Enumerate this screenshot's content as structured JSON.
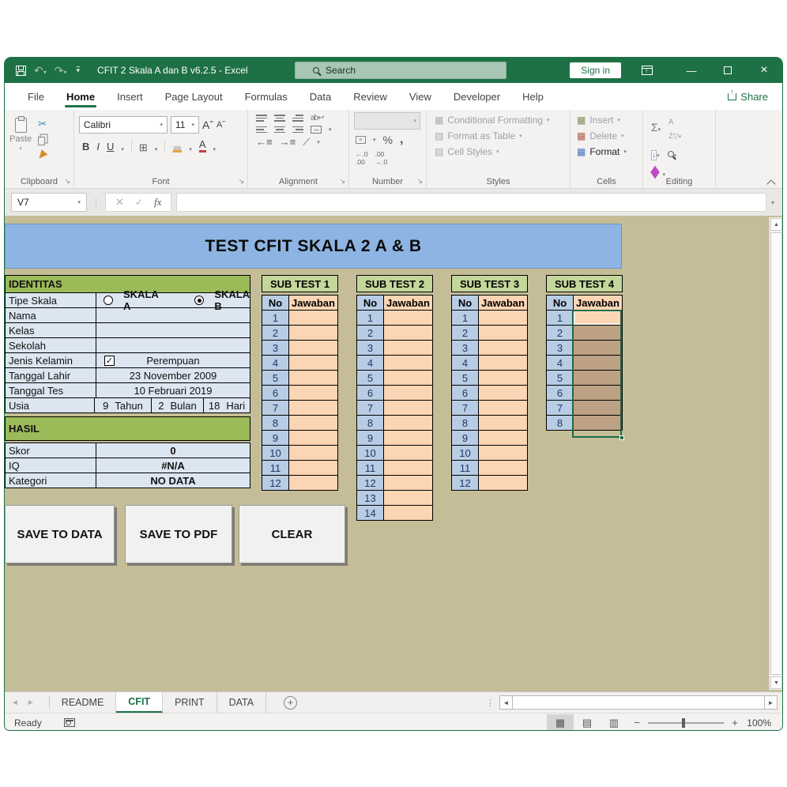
{
  "window": {
    "title": "CFIT 2 Skala A dan B v6.2.5  -  Excel"
  },
  "titlebar": {
    "search_placeholder": "Search",
    "sign_in": "Sign in"
  },
  "menu": {
    "tabs": [
      {
        "label": "File",
        "active": false
      },
      {
        "label": "Home",
        "active": true
      },
      {
        "label": "Insert",
        "active": false
      },
      {
        "label": "Page Layout",
        "active": false
      },
      {
        "label": "Formulas",
        "active": false
      },
      {
        "label": "Data",
        "active": false
      },
      {
        "label": "Review",
        "active": false
      },
      {
        "label": "View",
        "active": false
      },
      {
        "label": "Developer",
        "active": false
      },
      {
        "label": "Help",
        "active": false
      }
    ],
    "share": "Share"
  },
  "ribbon": {
    "clipboard": {
      "label": "Clipboard",
      "paste": "Paste"
    },
    "font": {
      "label": "Font",
      "family": "Calibri",
      "size": "11"
    },
    "alignment": {
      "label": "Alignment"
    },
    "number": {
      "label": "Number"
    },
    "styles": {
      "label": "Styles",
      "items": [
        "Conditional Formatting",
        "Format as Table",
        "Cell Styles"
      ]
    },
    "cells": {
      "label": "Cells",
      "items": [
        "Insert",
        "Delete",
        "Format"
      ]
    },
    "editing": {
      "label": "Editing"
    }
  },
  "formula_bar": {
    "name_box": "V7"
  },
  "sheet": {
    "banner": "TEST CFIT SKALA 2 A & B",
    "identitas": {
      "header": "IDENTITAS",
      "rows": [
        {
          "type": "radios",
          "label": "Tipe Skala",
          "options": [
            {
              "label": "SKALA A",
              "checked": false
            },
            {
              "label": "SKALA B",
              "checked": true
            }
          ]
        },
        {
          "type": "text",
          "label": "Nama",
          "value": ""
        },
        {
          "type": "text",
          "label": "Kelas",
          "value": ""
        },
        {
          "type": "text",
          "label": "Sekolah",
          "value": ""
        },
        {
          "type": "checkbox",
          "label": "Jenis Kelamin",
          "checked": true,
          "value": "Perempuan"
        },
        {
          "type": "text",
          "label": "Tanggal Lahir",
          "value": "23 November 2009"
        },
        {
          "type": "text",
          "label": "Tanggal Tes",
          "value": "10 Februari 2019"
        },
        {
          "type": "tripart",
          "label": "Usia",
          "parts": [
            {
              "num": "9",
              "unit": "Tahun"
            },
            {
              "num": "2",
              "unit": "Bulan"
            },
            {
              "num": "18",
              "unit": "Hari"
            }
          ]
        }
      ]
    },
    "hasil": {
      "header": "HASIL",
      "rows": [
        {
          "label": "Skor",
          "value": "0"
        },
        {
          "label": "IQ",
          "value": "#N/A"
        },
        {
          "label": "Kategori",
          "value": "NO DATA"
        }
      ]
    },
    "subtests": [
      {
        "title": "SUB TEST 1",
        "col_no": "No",
        "col_jawaban": "Jawaban",
        "row_count": 12,
        "selected": false
      },
      {
        "title": "SUB TEST 2",
        "col_no": "No",
        "col_jawaban": "Jawaban",
        "row_count": 14,
        "selected": false
      },
      {
        "title": "SUB TEST 3",
        "col_no": "No",
        "col_jawaban": "Jawaban",
        "row_count": 12,
        "selected": false
      },
      {
        "title": "SUB TEST 4",
        "col_no": "No",
        "col_jawaban": "Jawaban",
        "row_count": 8,
        "selected": true
      }
    ],
    "buttons": [
      "SAVE TO DATA",
      "SAVE TO PDF",
      "CLEAR"
    ]
  },
  "sheet_tabs": {
    "tabs": [
      {
        "label": "README",
        "active": false
      },
      {
        "label": "CFIT",
        "active": true
      },
      {
        "label": "PRINT",
        "active": false
      },
      {
        "label": "DATA",
        "active": false
      }
    ]
  },
  "status_bar": {
    "mode": "Ready",
    "zoom": "100%"
  },
  "colors": {
    "excel_green": "#1E7145",
    "banner_blue": "#8DB4E2",
    "header_green": "#9BBB59",
    "subtest_green": "#C4D79B",
    "row_blue": "#DCE6F1",
    "no_blue": "#B8CCE4",
    "jawaban_peach": "#FCD5B4",
    "sheet_tan": "#C4BD97",
    "selected_cell": "#BCA184"
  }
}
